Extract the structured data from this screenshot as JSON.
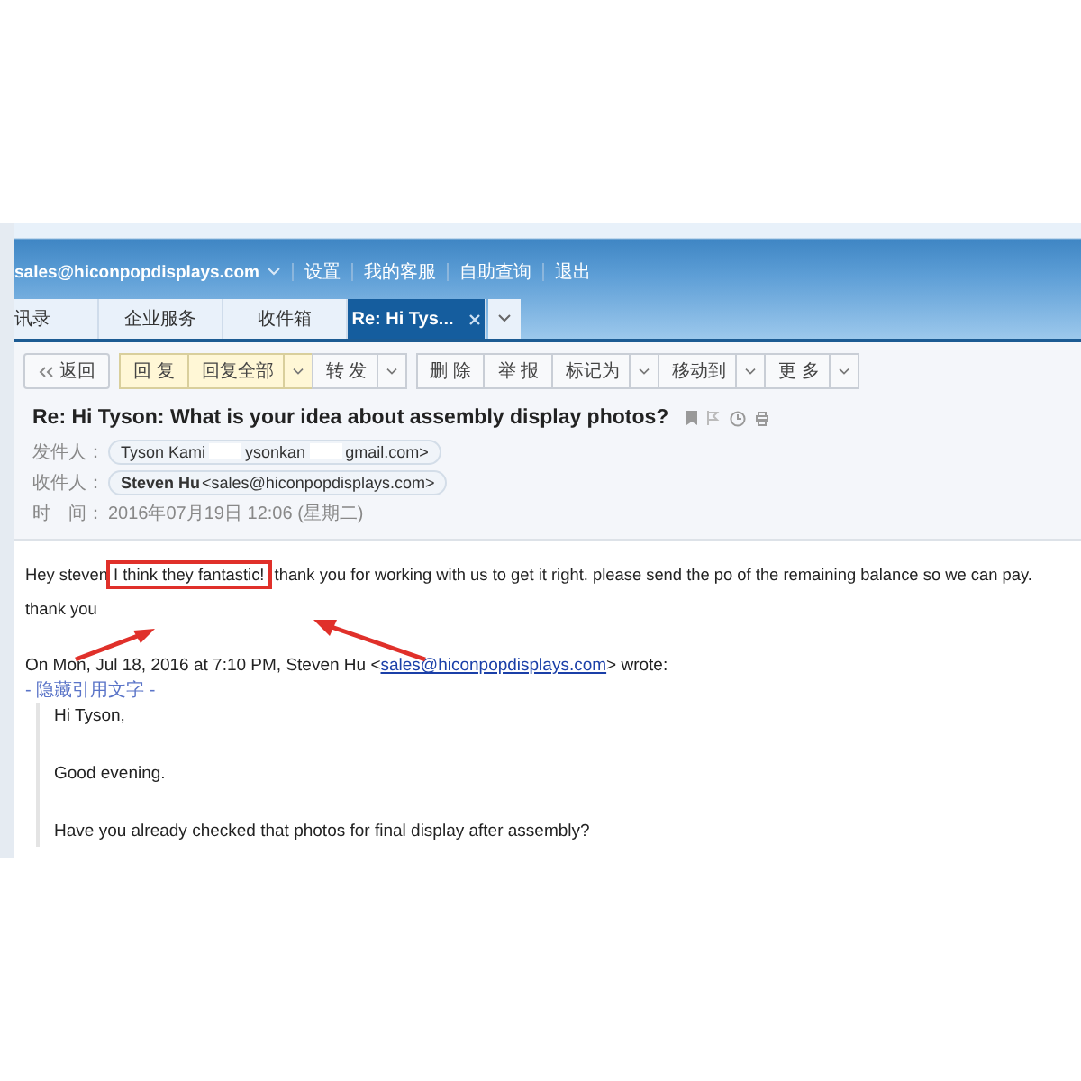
{
  "header": {
    "account": "sales@hiconpopdisplays.com",
    "links": [
      "设置",
      "我的客服",
      "自助查询",
      "退出"
    ]
  },
  "tabs": [
    {
      "label": "讯录",
      "selected": false,
      "closable": false
    },
    {
      "label": "企业服务",
      "selected": false,
      "closable": false
    },
    {
      "label": "收件箱",
      "selected": false,
      "closable": false
    },
    {
      "label": "Re: Hi Tys...",
      "selected": true,
      "closable": true
    }
  ],
  "toolbar": [
    {
      "kind": "back",
      "label": "返回"
    },
    {
      "kind": "group",
      "items": [
        {
          "label": "回 复",
          "highlighted": true,
          "dropdown": false
        },
        {
          "label": "回复全部",
          "highlighted": true,
          "dropdown": true
        },
        {
          "label": "转 发",
          "highlighted": false,
          "dropdown": true
        }
      ]
    },
    {
      "kind": "group",
      "items": [
        {
          "label": "删 除",
          "highlighted": false,
          "dropdown": false
        },
        {
          "label": "举 报",
          "highlighted": false,
          "dropdown": false
        },
        {
          "label": "标记为",
          "highlighted": false,
          "dropdown": true
        },
        {
          "label": "移动到",
          "highlighted": false,
          "dropdown": true
        },
        {
          "label": "更 多",
          "highlighted": false,
          "dropdown": true
        }
      ]
    }
  ],
  "message": {
    "subject": "Re: Hi Tyson: What is your idea about assembly display photos?",
    "from_label": "发件人：",
    "from_parts": [
      "Tyson Kami",
      "ysonkan",
      "gmail.com>"
    ],
    "to_label": "收件人：",
    "to_name": "Steven Hu",
    "to_address": "<sales@hiconpopdisplays.com>",
    "time_label": "时　间：",
    "time": "2016年07月19日 12:06 (星期二)"
  },
  "body": {
    "before": "Hey steven",
    "highlighted": "I think they fantastic!",
    "after": " thank you for working with us to get it right. please send the po of the remaining balance so we can pay. thank you",
    "quote_header_before": "On Mon, Jul 18, 2016 at 7:10 PM, Steven Hu <",
    "quote_link": "sales@hiconpopdisplays.com",
    "quote_header_after": "> wrote:",
    "hide_quote": "- 隐藏引用文字 -",
    "quote": [
      "Hi Tyson,",
      "Good evening.",
      "Have you already checked that photos for final display after assembly?"
    ]
  }
}
